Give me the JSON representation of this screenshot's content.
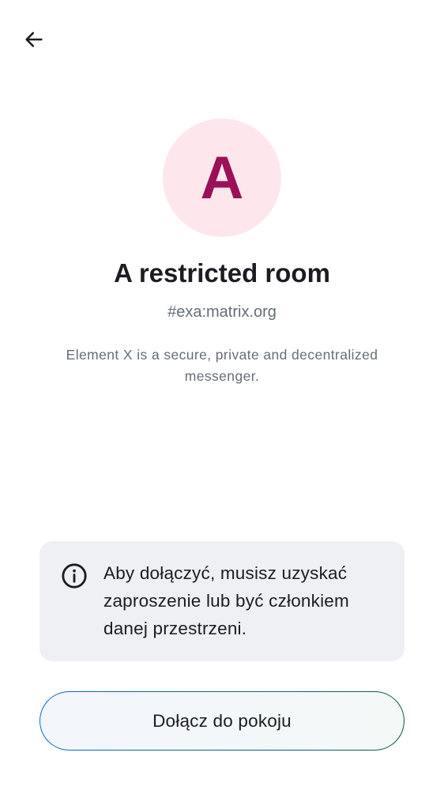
{
  "header": {
    "back_icon": "arrow-left-icon"
  },
  "room": {
    "avatar_letter": "A",
    "avatar_color": "#9b1057",
    "avatar_bg": "#fde7ec",
    "title": "A restricted room",
    "alias": "#exa:matrix.org",
    "description": "Element X is a secure, private and decentralized messenger."
  },
  "notice": {
    "icon": "info-icon",
    "text": "Aby dołączyć, musisz uzyskać zaproszenie lub być członkiem danej przestrzeni."
  },
  "actions": {
    "join_label": "Dołącz do pokoju"
  }
}
